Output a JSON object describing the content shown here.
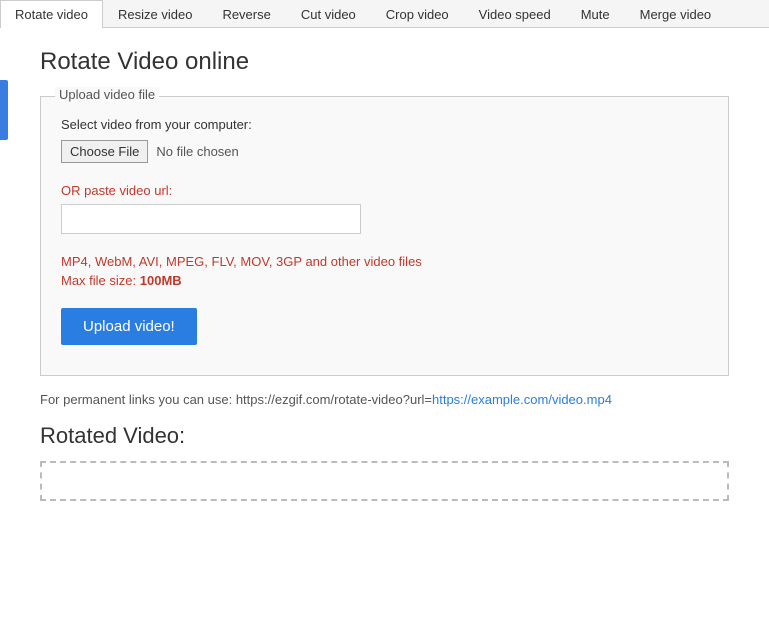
{
  "tabs": [
    {
      "label": "Rotate video",
      "active": true
    },
    {
      "label": "Resize video",
      "active": false
    },
    {
      "label": "Reverse",
      "active": false
    },
    {
      "label": "Cut video",
      "active": false
    },
    {
      "label": "Crop video",
      "active": false
    },
    {
      "label": "Video speed",
      "active": false
    },
    {
      "label": "Mute",
      "active": false
    },
    {
      "label": "Merge video",
      "active": false
    }
  ],
  "page": {
    "title": "Rotate Video online",
    "upload_box_legend": "Upload video file",
    "select_label": "Select video from your computer:",
    "choose_file_btn": "Choose File",
    "no_file_text": "No file chosen",
    "or_paste_label": "OR paste video url:",
    "url_placeholder": "",
    "formats_text": "MP4, WebM, AVI, MPEG, FLV, MOV, 3GP and other video files",
    "maxsize_prefix": "Max file size: ",
    "maxsize_value": "100MB",
    "upload_btn": "Upload video!",
    "permanent_link_prefix": "For permanent links you can use: https://ezgif.com/rotate-video?url=",
    "permanent_link_example": "https://example.com/video.mp4",
    "rotated_title": "Rotated Video:"
  }
}
